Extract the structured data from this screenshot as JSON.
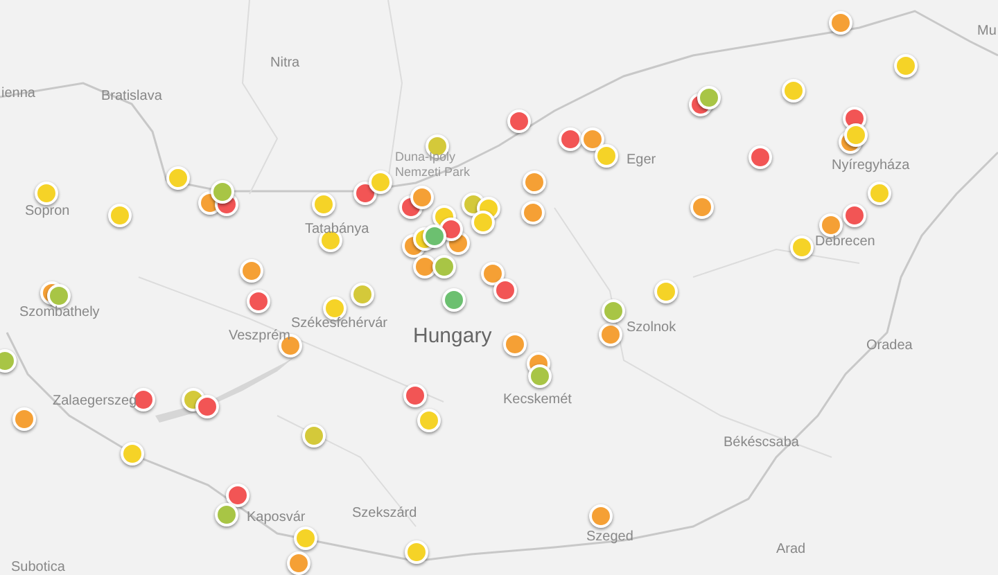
{
  "map_labels": [
    "ienna",
    "Bratislava",
    "Nitra",
    "Sopron",
    "Tatabánya",
    "Eger",
    "Nyíregyháza",
    "Debrecen",
    "Mu",
    "Szombathely",
    "Székesfehérvár",
    "Veszprém",
    "Zalaegerszeg",
    "Hungary",
    "Szolnok",
    "Kecskemét",
    "Oradea",
    "Békéscsaba",
    "Kaposvár",
    "Szekszárd",
    "Szeged",
    "Arad",
    "Subotica",
    "Duna-Ipoly Nemzeti Park"
  ],
  "pins": [
    {
      "color": "#f5a035"
    },
    {
      "color": "#f5d327"
    },
    {
      "color": "#f5d327"
    },
    {
      "color": "#f25555"
    },
    {
      "color": "#a8c545"
    },
    {
      "color": "#f25555"
    },
    {
      "color": "#f25555"
    },
    {
      "color": "#f5a035"
    },
    {
      "color": "#f5d327"
    },
    {
      "color": "#f25555"
    },
    {
      "color": "#f25555"
    },
    {
      "color": "#f5a035"
    },
    {
      "color": "#f5d327"
    },
    {
      "color": "#d4c93a"
    },
    {
      "color": "#f5d327"
    },
    {
      "color": "#f5d327"
    },
    {
      "color": "#f5d327"
    },
    {
      "color": "#f5a035"
    },
    {
      "color": "#f25555"
    },
    {
      "color": "#a8c545"
    },
    {
      "color": "#f5d327"
    },
    {
      "color": "#f25555"
    },
    {
      "color": "#f5d327"
    },
    {
      "color": "#f5a035"
    },
    {
      "color": "#f5a035"
    },
    {
      "color": "#f5a035"
    },
    {
      "color": "#f5d327"
    },
    {
      "color": "#f25555"
    },
    {
      "color": "#f5a035"
    },
    {
      "color": "#f5d327"
    },
    {
      "color": "#f25555"
    },
    {
      "color": "#f5a035"
    },
    {
      "color": "#f5d327"
    },
    {
      "color": "#d4c93a"
    },
    {
      "color": "#f5d327"
    },
    {
      "color": "#f5a035"
    },
    {
      "color": "#f5d327"
    },
    {
      "color": "#f5a035"
    },
    {
      "color": "#f5a035"
    },
    {
      "color": "#f5d327"
    },
    {
      "color": "#f25555"
    },
    {
      "color": "#6cc070"
    },
    {
      "color": "#a8c545"
    },
    {
      "color": "#f5d327"
    },
    {
      "color": "#f5a035"
    },
    {
      "color": "#f25555"
    },
    {
      "color": "#f5d327"
    },
    {
      "color": "#d4c93a"
    },
    {
      "color": "#6cc070"
    },
    {
      "color": "#f5a035"
    },
    {
      "color": "#f25555"
    },
    {
      "color": "#f5a035"
    },
    {
      "color": "#a8c545"
    },
    {
      "color": "#f5d327"
    },
    {
      "color": "#f5a035"
    },
    {
      "color": "#a8c545"
    },
    {
      "color": "#a8c545"
    },
    {
      "color": "#f5a035"
    },
    {
      "color": "#f5a035"
    },
    {
      "color": "#f5a035"
    },
    {
      "color": "#f5a035"
    },
    {
      "color": "#a8c545"
    },
    {
      "color": "#f25555"
    },
    {
      "color": "#d4c93a"
    },
    {
      "color": "#f25555"
    },
    {
      "color": "#f25555"
    },
    {
      "color": "#f5d327"
    },
    {
      "color": "#d4c93a"
    },
    {
      "color": "#f5d327"
    },
    {
      "color": "#f25555"
    },
    {
      "color": "#a8c545"
    },
    {
      "color": "#f5d327"
    },
    {
      "color": "#f5a035"
    },
    {
      "color": "#f5d327"
    },
    {
      "color": "#f5a035"
    }
  ]
}
